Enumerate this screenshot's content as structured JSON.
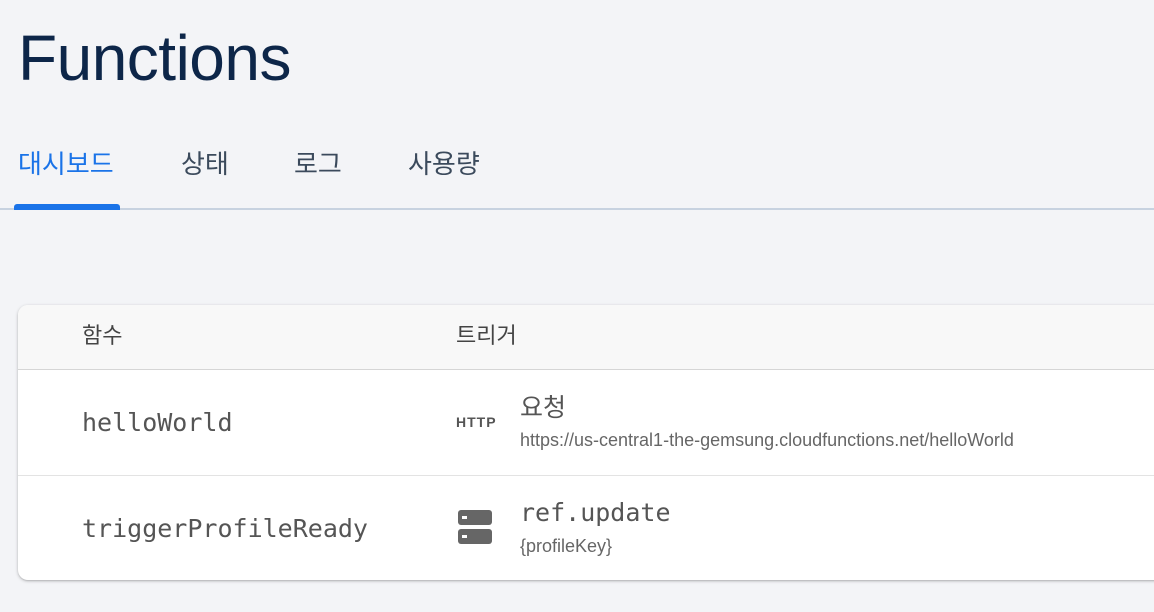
{
  "header": {
    "title": "Functions"
  },
  "tabs": [
    {
      "label": "대시보드",
      "active": true
    },
    {
      "label": "상태",
      "active": false
    },
    {
      "label": "로그",
      "active": false
    },
    {
      "label": "사용량",
      "active": false
    }
  ],
  "table": {
    "columns": [
      "함수",
      "트리거"
    ],
    "rows": [
      {
        "function": "helloWorld",
        "trigger_icon": "http-icon",
        "trigger_icon_text": "HTTP",
        "trigger_title": "요청",
        "trigger_detail": "https://us-central1-the-gemsung.cloudfunctions.net/helloWorld"
      },
      {
        "function": "triggerProfileReady",
        "trigger_icon": "database-icon",
        "trigger_title": "ref.update",
        "trigger_detail": "{profileKey}"
      }
    ]
  },
  "colors": {
    "accent": "#1a73e8",
    "title": "#0d2649",
    "background": "#f3f4f7"
  }
}
